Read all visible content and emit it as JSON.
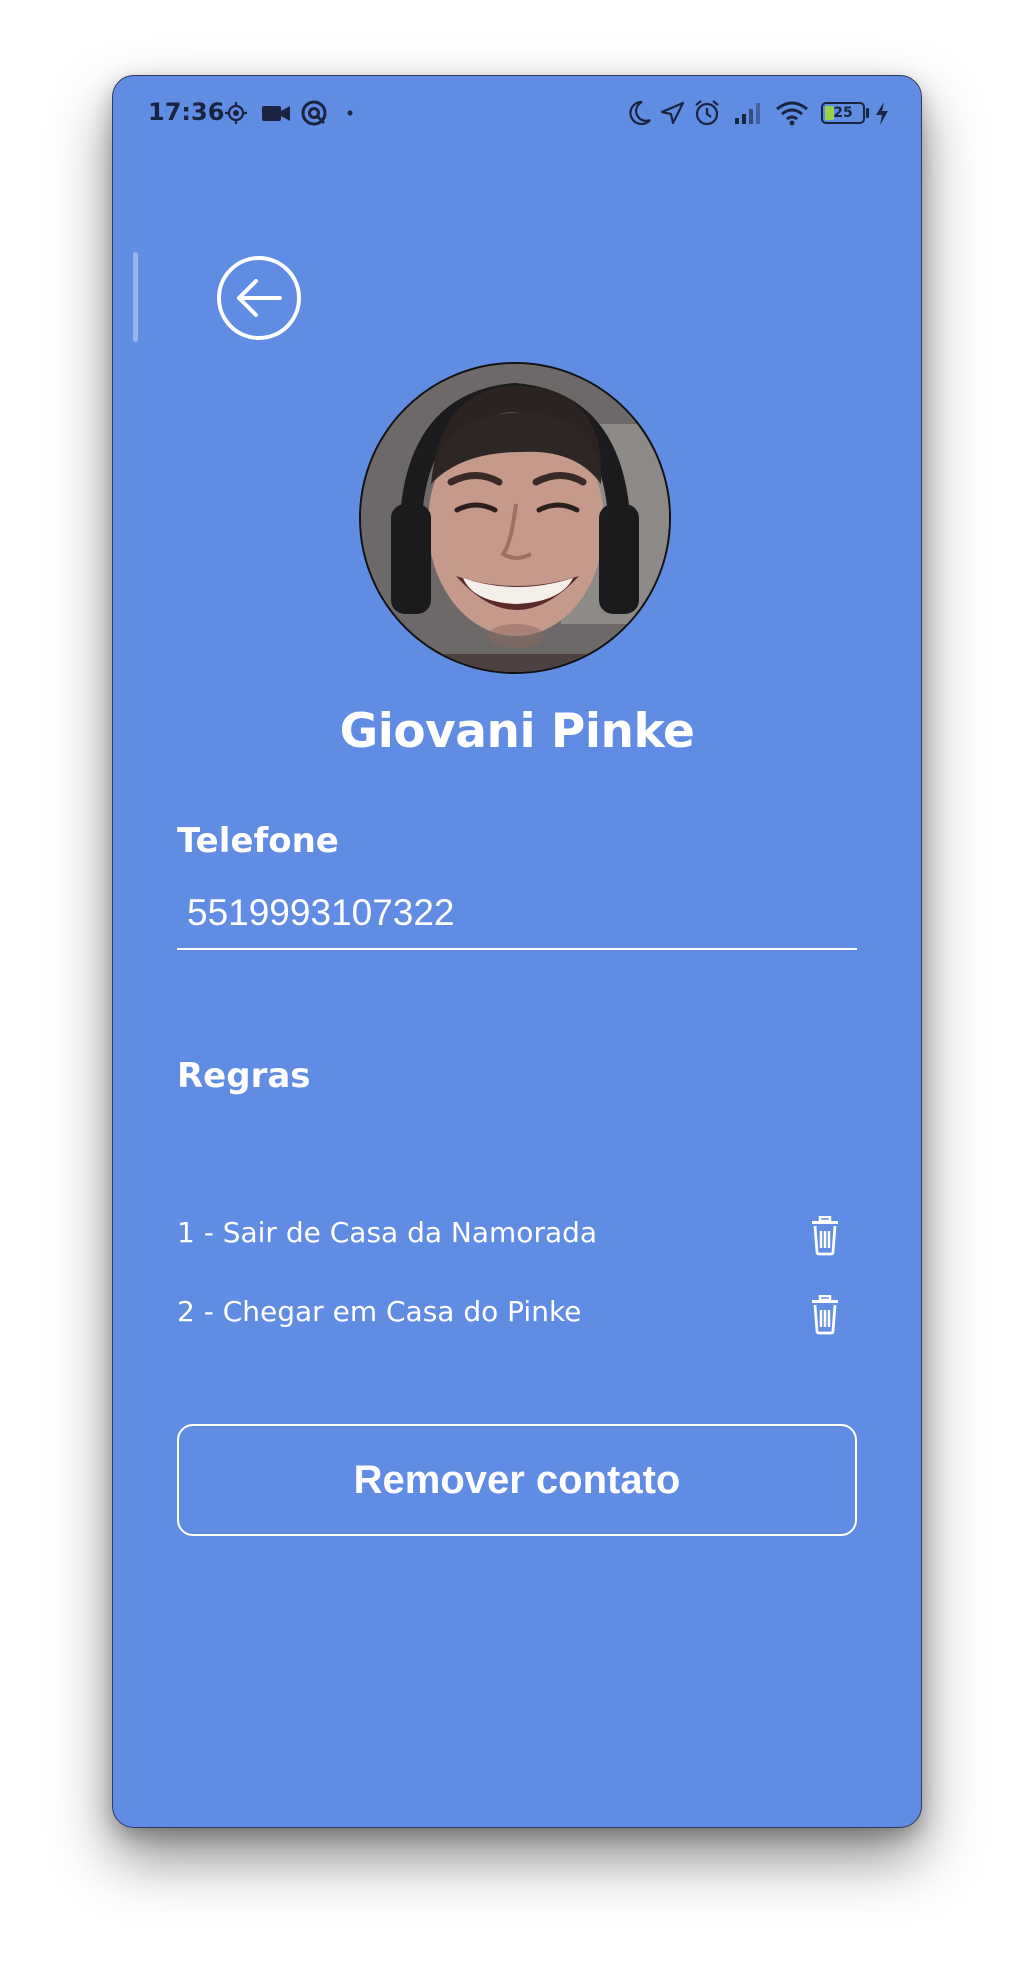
{
  "status_bar": {
    "time": "17:36",
    "battery_level": "25",
    "battery_fraction": 0.25,
    "icons": [
      "location-target-icon",
      "video-camera-icon",
      "at-sign-icon",
      "dot-icon",
      "moon-icon",
      "navigation-arrow-icon",
      "alarm-clock-icon",
      "signal-bars-icon",
      "wifi-icon",
      "battery-icon",
      "charging-bolt-icon"
    ]
  },
  "colors": {
    "background": "#618ce3",
    "foreground": "#ffffff",
    "status_text": "#1a2340",
    "battery_fill": "#9ad14a"
  },
  "header": {
    "back_icon": "arrow-left-circle-icon"
  },
  "contact": {
    "name": "Giovani Pinke",
    "avatar": "contact-photo"
  },
  "phone_section": {
    "label": "Telefone",
    "value": "5519993107322"
  },
  "rules_section": {
    "label": "Regras",
    "items": [
      {
        "text": "1 - Sair de Casa da Namorada",
        "action_icon": "trash-icon"
      },
      {
        "text": "2 - Chegar em Casa do Pinke",
        "action_icon": "trash-icon"
      }
    ]
  },
  "actions": {
    "remove_label": "Remover contato"
  }
}
